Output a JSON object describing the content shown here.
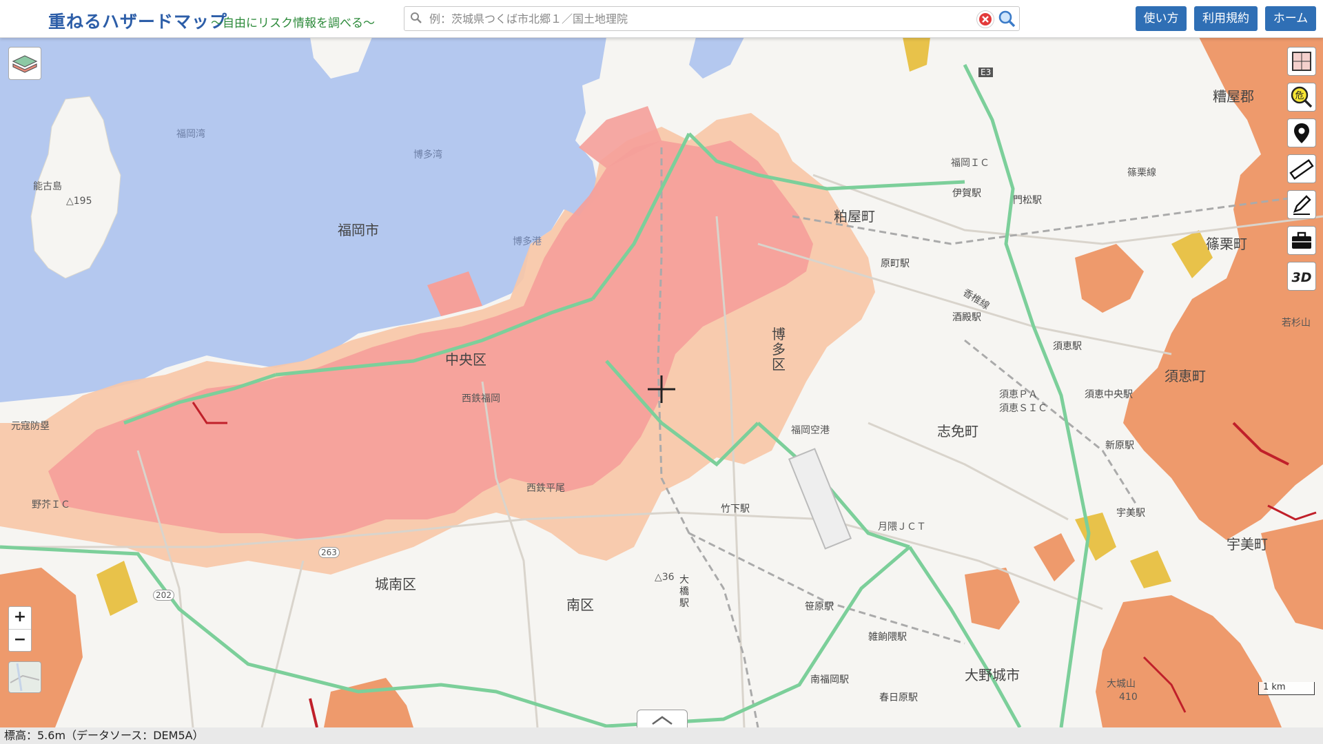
{
  "header": {
    "title": "重ねるハザードマップ",
    "subtitle": "〜自由にリスク情報を調べる〜",
    "search_placeholder": "例：茨城県つくば市北郷１／国土地理院",
    "nav": [
      {
        "label": "使い方"
      },
      {
        "label": "利用規約"
      },
      {
        "label": "ホーム"
      }
    ]
  },
  "map": {
    "labels": {
      "fukuoka_city": "福岡市",
      "chuo_ku": "中央区",
      "jonan_ku": "城南区",
      "minami_ku": "南区",
      "hakata_ku": "博多区",
      "kasuya_machi": "粕屋町",
      "shime_machi": "志免町",
      "sasaguri_machi": "篠栗町",
      "ohnojo_city": "大野城市",
      "umi_machi": "宇美町",
      "sue_machi": "須恵町",
      "kasuya_gun": "糟屋郡",
      "nokonoshima": "能古島",
      "nokonoshima_elev": "△195",
      "hakata_bay": "博多湾",
      "fukuoka_bay": "福岡湾",
      "hakata_port": "博多港",
      "fukuoka_airport": "福岡空港",
      "nishitetsu_fukuoka": "西鉄福岡",
      "nishitetsu_hirao": "西鉄平尾",
      "takeshita_sta": "竹下駅",
      "sasahara_sta": "笹原駅",
      "zasshonokuma_sta": "雑餉隈駅",
      "minamifukuoka_sta": "南福岡駅",
      "kasugabaru_sta": "春日原駅",
      "ohashi_sta": "大橋駅",
      "harumachi_sta": "原町駅",
      "sakado_sta": "酒殿駅",
      "sue_sta": "須恵駅",
      "suenakano_sta": "須恵中央駅",
      "shinbaru_sta": "新原駅",
      "umimi_sta": "宇美駅",
      "igano_sta": "伊賀駅",
      "kadomatsu_sta": "門松駅",
      "fukuoka_ic": "福岡ＩＣ",
      "sue_pa": "須恵ＰＡ",
      "sue_sic": "須恵ＳＩＣ",
      "tsukiguma_jct": "月隈ＪＣＴ",
      "nokata_ic": "野芥ＩＣ",
      "genkai": "元寇防塁",
      "sasaguri_line": "篠栗線",
      "kashii_line": "香椎線",
      "elev36": "△36",
      "elev410": "410",
      "tachibana_yama": "若杉山",
      "ohtsuka_yama": "大城山",
      "route_e3": "E3",
      "route_263": "263",
      "route_202": "202"
    },
    "scale_label": "1 km",
    "colors": {
      "sea": "#b4c8ef",
      "land": "#f6f5f2",
      "flood": "#f5a09a",
      "flood_light": "#f8c6a6",
      "landslide": "#ee9a6c",
      "steep": "#e8c24a",
      "danger_red": "#c0202a",
      "expressway": "#7ccf9a",
      "accent": "#2f6fb5"
    }
  },
  "tools": [
    "layer-map-icon",
    "hazard-search-icon",
    "location-pin-icon",
    "ruler-icon",
    "pencil-icon",
    "toolbox-icon",
    "3d-icon"
  ],
  "status": {
    "text": "標高：5.6m（データソース：DEM5A）"
  }
}
